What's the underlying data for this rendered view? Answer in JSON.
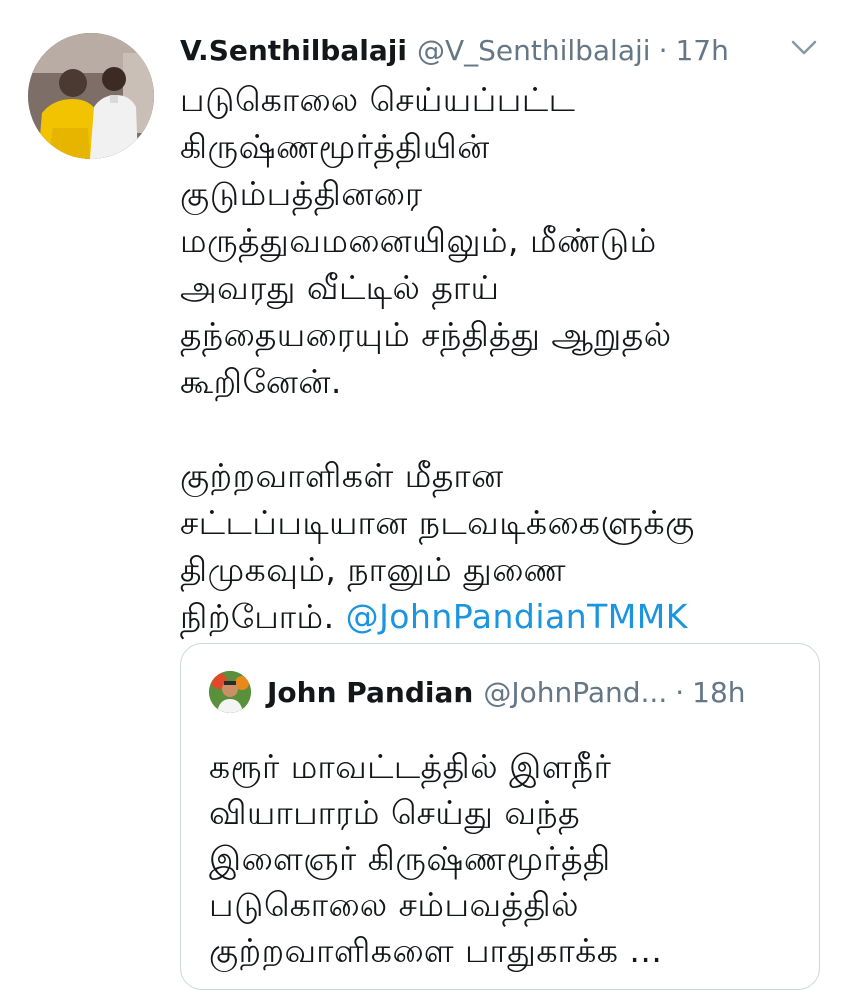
{
  "tweet": {
    "author_name": "V.Senthilbalaji",
    "author_handle": "@V_Senthilbalaji",
    "separator": "·",
    "time": "17h",
    "icons": {
      "menu": "chevron-down-icon",
      "avatar": "profile-photo"
    },
    "text_lines": [
      "படுகொலை செய்யப்பட்ட",
      "கிருஷ்ணமூர்த்தியின்",
      "குடும்பத்தினரை",
      "மருத்துவமனையிலும்,  மீண்டும்",
      "அவரது வீட்டில் தாய்",
      "தந்தையரையும் சந்தித்து ஆறுதல்",
      "கூறினேன்.",
      "",
      "குற்றவாளிகள் மீதான",
      "சட்டப்படியான நடவடிக்கைளுக்கு",
      "திமுகவும், நானும் துணை"
    ],
    "last_line_text": "நிற்போம். ",
    "mention": "@JohnPandianTMMK"
  },
  "quoted_tweet": {
    "author_name": "John Pandian",
    "author_handle": "@JohnPand...",
    "separator": "·",
    "time": "18h",
    "text_lines": [
      "கரூர் மாவட்டத்தில் இளநீர்",
      "வியாபாரம் செய்து வந்த",
      "இளைஞர் கிருஷ்ணமூர்த்தி",
      "படுகொலை சம்பவத்தில்",
      "குற்றவாளிகளை பாதுகாக்க ..."
    ]
  },
  "colors": {
    "text": "#14171a",
    "secondary": "#657786",
    "link": "#1b95e0",
    "border": "#ccd6dd"
  }
}
